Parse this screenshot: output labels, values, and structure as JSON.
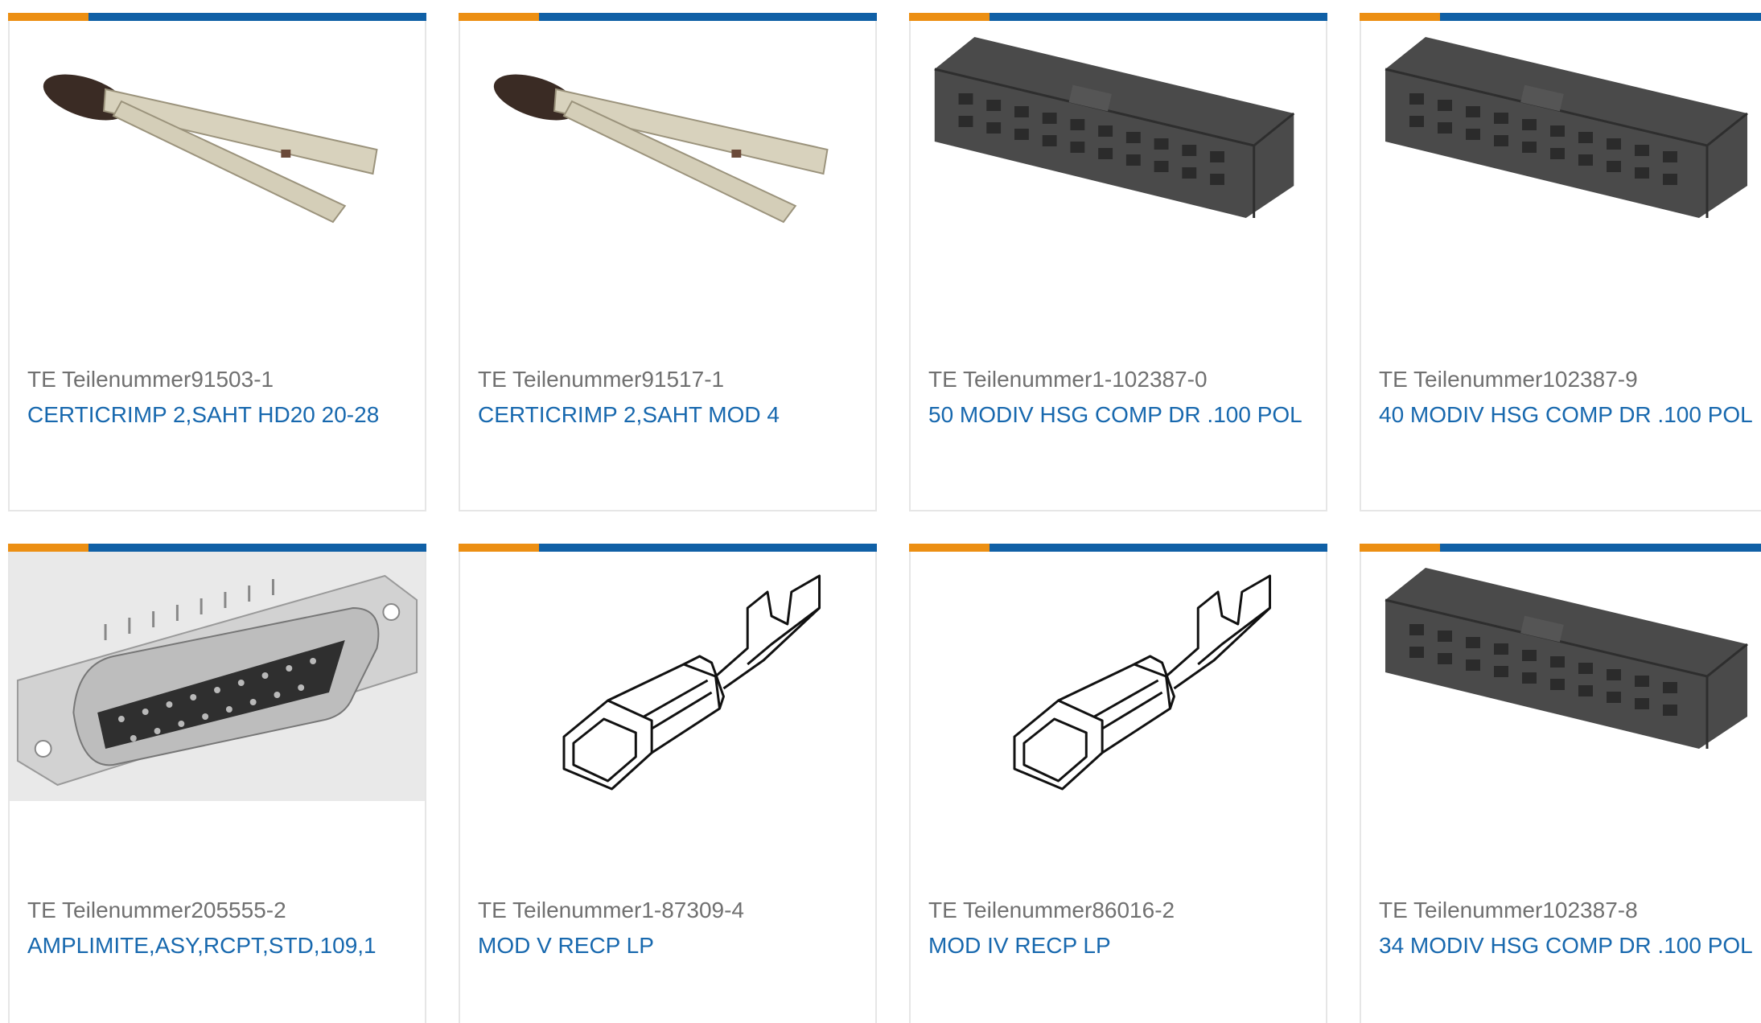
{
  "cards": [
    {
      "part_prefix": "TE Teilenummer",
      "part_number": "91503-1",
      "description": "CERTICRIMP 2,SAHT HD20 20-28",
      "image": "crimp-tool-icon"
    },
    {
      "part_prefix": "TE Teilenummer",
      "part_number": "91517-1",
      "description": "CERTICRIMP 2,SAHT MOD 4",
      "image": "crimp-tool-icon"
    },
    {
      "part_prefix": "TE Teilenummer",
      "part_number": "1-102387-0",
      "description": "50 MODIV HSG COMP DR .100 POL",
      "image": "connector-housing-icon"
    },
    {
      "part_prefix": "TE Teilenummer",
      "part_number": "102387-9",
      "description": "40 MODIV HSG COMP DR .100 POL",
      "image": "connector-housing-icon"
    },
    {
      "part_prefix": "TE Teilenummer",
      "part_number": "205555-2",
      "description": "AMPLIMITE,ASY,RCPT,STD,109,1",
      "image": "d-sub-connector-icon"
    },
    {
      "part_prefix": "TE Teilenummer",
      "part_number": "1-87309-4",
      "description": "MOD V RECP LP",
      "image": "receptacle-contact-icon"
    },
    {
      "part_prefix": "TE Teilenummer",
      "part_number": "86016-2",
      "description": "MOD IV RECP LP",
      "image": "receptacle-contact-icon"
    },
    {
      "part_prefix": "TE Teilenummer",
      "part_number": "102387-8",
      "description": "34 MODIV HSG COMP DR .100 POL",
      "image": "connector-housing-icon"
    }
  ],
  "colors": {
    "accent_orange": "#ec8f13",
    "accent_blue": "#1060a6",
    "link": "#1768ae",
    "muted_text": "#707070"
  }
}
